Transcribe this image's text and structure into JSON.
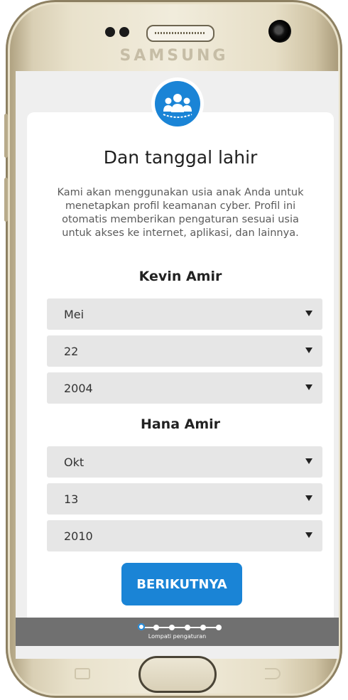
{
  "device": {
    "brand": "SAMSUNG"
  },
  "header": {
    "logo_icon": "family-group-icon"
  },
  "page": {
    "title": "Dan tanggal lahir",
    "description": "Kami akan menggunakan usia anak Anda untuk menetapkan profil keamanan cyber. Profil ini otomatis memberikan pengaturan sesuai usia untuk akses ke internet, aplikasi, dan lainnya."
  },
  "children": [
    {
      "name": "Kevin Amir",
      "month": "Mei",
      "day": "22",
      "year": "2004"
    },
    {
      "name": "Hana Amir",
      "month": "Okt",
      "day": "13",
      "year": "2010"
    }
  ],
  "actions": {
    "next_label": "BERIKUTNYA",
    "skip_label": "Lompati pengaturan"
  },
  "progress": {
    "total_steps": 6,
    "current_step": 1
  },
  "colors": {
    "accent": "#1a84d6",
    "card": "#ffffff",
    "screen_bg": "#efefef",
    "footer": "#707070",
    "select_bg": "#e6e6e6"
  }
}
